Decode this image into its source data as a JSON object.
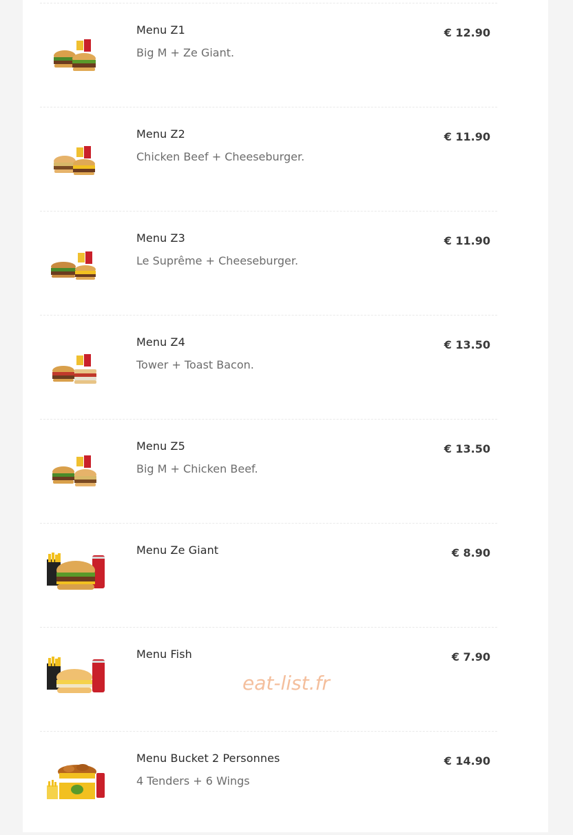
{
  "menu": {
    "items": [
      {
        "name": "Menu Z1",
        "description": "Big M + Ze Giant.",
        "price": "€ 12.90",
        "image": "two-burgers-fries-drink-icon"
      },
      {
        "name": "Menu Z2",
        "description": "Chicken Beef + Cheeseburger.",
        "price": "€ 11.90",
        "image": "two-burgers-fries-drink-icon"
      },
      {
        "name": "Menu Z3",
        "description": "Le Suprême + Cheeseburger.",
        "price": "€ 11.90",
        "image": "two-burgers-fries-drink-icon"
      },
      {
        "name": "Menu Z4",
        "description": "Tower + Toast Bacon.",
        "price": "€ 13.50",
        "image": "two-burgers-fries-drink-icon"
      },
      {
        "name": "Menu Z5",
        "description": "Big M + Chicken Beef.",
        "price": "€ 13.50",
        "image": "two-burgers-fries-drink-icon"
      },
      {
        "name": "Menu Ze Giant",
        "description": "",
        "price": "€ 8.90",
        "image": "burger-fries-cola-icon"
      },
      {
        "name": "Menu Fish",
        "description": "",
        "price": "€ 7.90",
        "image": "fish-burger-fries-cola-icon"
      },
      {
        "name": "Menu Bucket 2 Personnes",
        "description": "4 Tenders + 6 Wings",
        "price": "€ 14.90",
        "image": "chicken-bucket-icon"
      }
    ]
  },
  "watermark": "eat-list.fr"
}
